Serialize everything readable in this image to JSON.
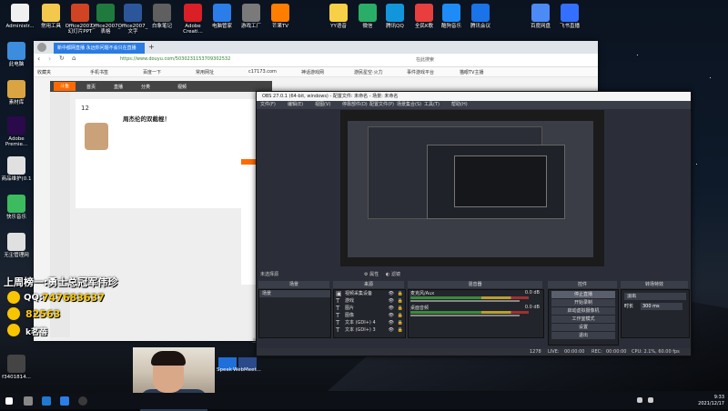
{
  "desktop": {
    "top_icons": [
      {
        "label": "Administr...",
        "color": "#f0f0f0"
      },
      {
        "label": "常用工具",
        "color": "#f2c94c"
      },
      {
        "label": "Office2007_幻灯片PPT",
        "color": "#d04423"
      },
      {
        "label": "Office2007_表格",
        "color": "#1f7a3d"
      },
      {
        "label": "Office2007_文字",
        "color": "#2b579a"
      },
      {
        "label": "白象笔记",
        "color": "#5f5f5f"
      },
      {
        "label": "Adobe Creati...",
        "color": "#da1f26"
      },
      {
        "label": "电脑管家",
        "color": "#2b7de9"
      },
      {
        "label": "游戏工厂",
        "color": "#7a7a7a"
      },
      {
        "label": "芒果TV",
        "color": "#ff7d00"
      },
      {
        "label": "YY语音",
        "color": "#f8d047"
      },
      {
        "label": "微信",
        "color": "#2aae67"
      },
      {
        "label": "腾讯QQ",
        "color": "#1296db"
      },
      {
        "label": "全民K歌",
        "color": "#e83e3e"
      },
      {
        "label": "酷狗音乐",
        "color": "#1d8cf8"
      },
      {
        "label": "腾讯会议",
        "color": "#1a73e8"
      },
      {
        "label": "百度网盘",
        "color": "#4c8bf5"
      },
      {
        "label": "飞书直播",
        "color": "#3370ff"
      }
    ],
    "left_icons": [
      {
        "label": "此电脑",
        "color": "#3c8dde"
      },
      {
        "label": "素材库",
        "color": "#d9a441"
      },
      {
        "label": "Adobe Premie...",
        "color": "#2a0a4a"
      },
      {
        "label": "商品维护(0.1",
        "color": "#e0e0e0"
      },
      {
        "label": "快乐音乐",
        "color": "#3dbb5f"
      },
      {
        "label": "无尘管理网",
        "color": "#e0e0e0"
      },
      {
        "label": "f3401814...",
        "color": "#444444"
      }
    ]
  },
  "browser": {
    "tab_title": "新中都网直播 永远你问题不会只在直播",
    "url": "https://www.douyu.com/5030231153709302532",
    "search_placeholder": "在此搜索",
    "bookmarks": [
      "收藏夹",
      "手机书签",
      "百度一下",
      "常用网址",
      "c17173.com",
      "神话游戏网",
      "游民星空·火力",
      "事件游戏平台",
      "猫眼TV主播"
    ],
    "page": {
      "nav": [
        "首页",
        "直播",
        "分类",
        "视频"
      ],
      "room_number": "12",
      "streamer_title": "周杰伦的双截棍！",
      "footer_hint": "当前无语"
    }
  },
  "obs": {
    "title": "OBS 27.0.1 (64-bit, windows) - 配置文件: 未命名 - 场景: 未命名",
    "menu": [
      "文件(F)",
      "编辑(E)",
      "视图(V)",
      "停靠部件(D)",
      "配置文件(P)",
      "场景集合(S)",
      "工具(T)",
      "帮助(H)"
    ],
    "no_source_selected": "未选择源",
    "properties_btn": "属性",
    "filters_btn": "滤镜",
    "scenes_header": "场景",
    "sources_header": "来源",
    "mixer_header": "混音器",
    "transitions_header": "转场特效",
    "controls_header": "控件",
    "scene_items": [
      "场景"
    ],
    "sources": [
      {
        "icon": "▣",
        "label": "视频采集设备"
      },
      {
        "icon": "T",
        "label": "游戏"
      },
      {
        "icon": "T",
        "label": "图片"
      },
      {
        "icon": "T",
        "label": "图像"
      },
      {
        "icon": "T",
        "label": "文本 (GDI+) 4"
      },
      {
        "icon": "T",
        "label": "文本 (GDI+) 3"
      }
    ],
    "mixer": [
      {
        "label": "麦克风/Aux",
        "db": "0.0 dB"
      },
      {
        "label": "桌面音频",
        "db": "0.0 dB"
      }
    ],
    "transition": {
      "type": "淡出",
      "duration_label": "时长",
      "duration": "300 ms"
    },
    "controls": [
      "停止直播",
      "开始录制",
      "启动虚拟摄像机",
      "工作室模式",
      "设置",
      "退出"
    ],
    "status": {
      "live_label": "LIVE:",
      "live_time": "00:00:00",
      "rec_label": "REC:",
      "rec_time": "00:00:00",
      "cpu": "CPU: 2.1%, 60.00 fps",
      "kbps": "1278"
    }
  },
  "overlay": {
    "headline": "上周榜一:勇士总冠军伟珍",
    "qq_label": "QQ:",
    "qq_number": "747683637",
    "group_number": "82563",
    "user_name": "k茗蓓"
  },
  "taskbar": {
    "items": [
      "Speak",
      "WebMeet..."
    ],
    "time": "9:33",
    "date": "2021/12/17"
  }
}
